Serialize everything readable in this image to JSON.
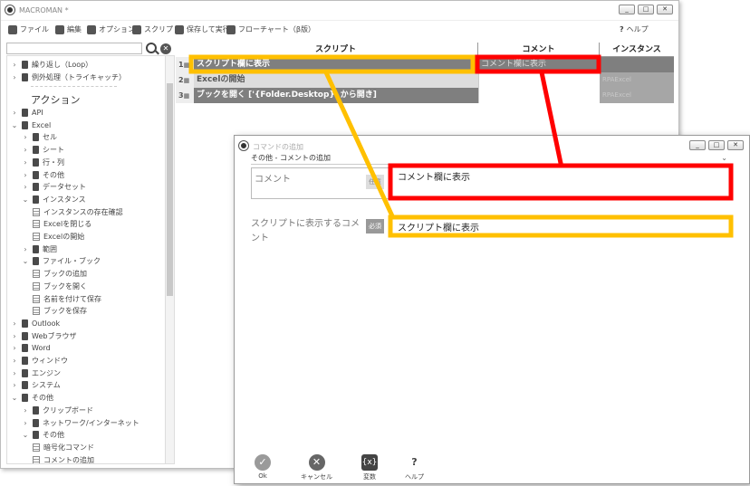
{
  "main_window": {
    "title": "MACROMAN *",
    "controls": [
      "_",
      "□",
      "✕"
    ]
  },
  "menubar": [
    {
      "label": "ファイル",
      "icon": "file-icon"
    },
    {
      "label": "編集",
      "icon": "edit-icon"
    },
    {
      "label": "オプション",
      "icon": "options-icon"
    },
    {
      "label": "スクリプト",
      "icon": "script-icon"
    },
    {
      "label": "保存して実行",
      "icon": "save-run-icon"
    },
    {
      "label": "フローチャート（β版）",
      "icon": "flowchart-icon"
    },
    {
      "label": "ヘルプ",
      "icon": "help-icon"
    }
  ],
  "search": {
    "value": "",
    "placeholder": ""
  },
  "sidebar": {
    "section_title": "アクション",
    "items": [
      {
        "label": "繰り返し（Loop）",
        "type": "folder",
        "state": "collapsed",
        "level": 0
      },
      {
        "label": "例外処理（トライキャッチ）",
        "type": "folder",
        "state": "collapsed",
        "level": 0
      },
      {
        "label": "API",
        "type": "folder",
        "state": "collapsed",
        "level": 0
      },
      {
        "label": "Excel",
        "type": "folder",
        "state": "expanded",
        "level": 0
      },
      {
        "label": "セル",
        "type": "folder",
        "state": "collapsed",
        "level": 1
      },
      {
        "label": "シート",
        "type": "folder",
        "state": "collapsed",
        "level": 1
      },
      {
        "label": "行・列",
        "type": "folder",
        "state": "collapsed",
        "level": 1
      },
      {
        "label": "その他",
        "type": "folder",
        "state": "collapsed",
        "level": 1
      },
      {
        "label": "データセット",
        "type": "folder",
        "state": "collapsed",
        "level": 1
      },
      {
        "label": "インスタンス",
        "type": "folder",
        "state": "expanded",
        "level": 1
      },
      {
        "label": "インスタンスの存在確認",
        "type": "doc",
        "level": 2
      },
      {
        "label": "Excelを閉じる",
        "type": "doc",
        "level": 2
      },
      {
        "label": "Excelの開始",
        "type": "doc",
        "level": 2
      },
      {
        "label": "範囲",
        "type": "folder",
        "state": "collapsed",
        "level": 1
      },
      {
        "label": "ファイル・ブック",
        "type": "folder",
        "state": "expanded",
        "level": 1
      },
      {
        "label": "ブックの追加",
        "type": "doc",
        "level": 2
      },
      {
        "label": "ブックを開く",
        "type": "doc",
        "level": 2
      },
      {
        "label": "名前を付けて保存",
        "type": "doc",
        "level": 2
      },
      {
        "label": "ブックを保存",
        "type": "doc",
        "level": 2
      },
      {
        "label": "Outlook",
        "type": "folder",
        "state": "collapsed",
        "level": 0
      },
      {
        "label": "Webブラウザ",
        "type": "folder",
        "state": "collapsed",
        "level": 0
      },
      {
        "label": "Word",
        "type": "folder",
        "state": "collapsed",
        "level": 0
      },
      {
        "label": "ウィンドウ",
        "type": "folder",
        "state": "collapsed",
        "level": 0
      },
      {
        "label": "エンジン",
        "type": "folder",
        "state": "collapsed",
        "level": 0
      },
      {
        "label": "システム",
        "type": "folder",
        "state": "collapsed",
        "level": 0
      },
      {
        "label": "その他",
        "type": "folder",
        "state": "expanded",
        "level": 0
      },
      {
        "label": "クリップボード",
        "type": "folder",
        "state": "collapsed",
        "level": 1
      },
      {
        "label": "ネットワーク/インターネット",
        "type": "folder",
        "state": "collapsed",
        "level": 1
      },
      {
        "label": "その他",
        "type": "folder",
        "state": "expanded",
        "level": 1
      },
      {
        "label": "暗号化コマンド",
        "type": "doc",
        "level": 2
      },
      {
        "label": "コメントの追加",
        "type": "doc",
        "level": 2
      }
    ]
  },
  "table": {
    "headers": [
      "スクリプト",
      "コメント",
      "インスタンス"
    ],
    "rows": [
      {
        "num": "1",
        "script": "スクリプト欄に表示",
        "comment": "コメント欄に表示",
        "instance": ""
      },
      {
        "num": "2",
        "script": "Excelの開始",
        "comment": "",
        "instance": "RPAExcel"
      },
      {
        "num": "3",
        "script": "ブックを開く ['{Folder.Desktop}' から開き]",
        "comment": "",
        "instance": "RPAExcel"
      }
    ]
  },
  "dialog": {
    "title": "コマンドの追加",
    "controls": [
      "_",
      "□",
      "✕"
    ],
    "category": "その他 - コメントの追加",
    "comment_label": "コメント",
    "comment_badge": "任意",
    "comment_value": "コメント欄に表示",
    "script_label": "スクリプトに表示するコメント",
    "script_badge": "必須",
    "script_value": "スクリプト欄に表示",
    "buttons": [
      {
        "label": "Ok",
        "icon": "check-icon",
        "glyph": "✓"
      },
      {
        "label": "キャンセル",
        "icon": "cancel-icon",
        "glyph": "✕"
      },
      {
        "label": "変数",
        "icon": "variable-icon",
        "glyph": "{x}"
      },
      {
        "label": "ヘルプ",
        "icon": "help-icon",
        "glyph": "?"
      }
    ]
  },
  "colors": {
    "annotation_yellow": "#FFC000",
    "annotation_red": "#FF0000",
    "selected_row": "#7f7f7f",
    "instance_cell": "#a6a6a6"
  }
}
